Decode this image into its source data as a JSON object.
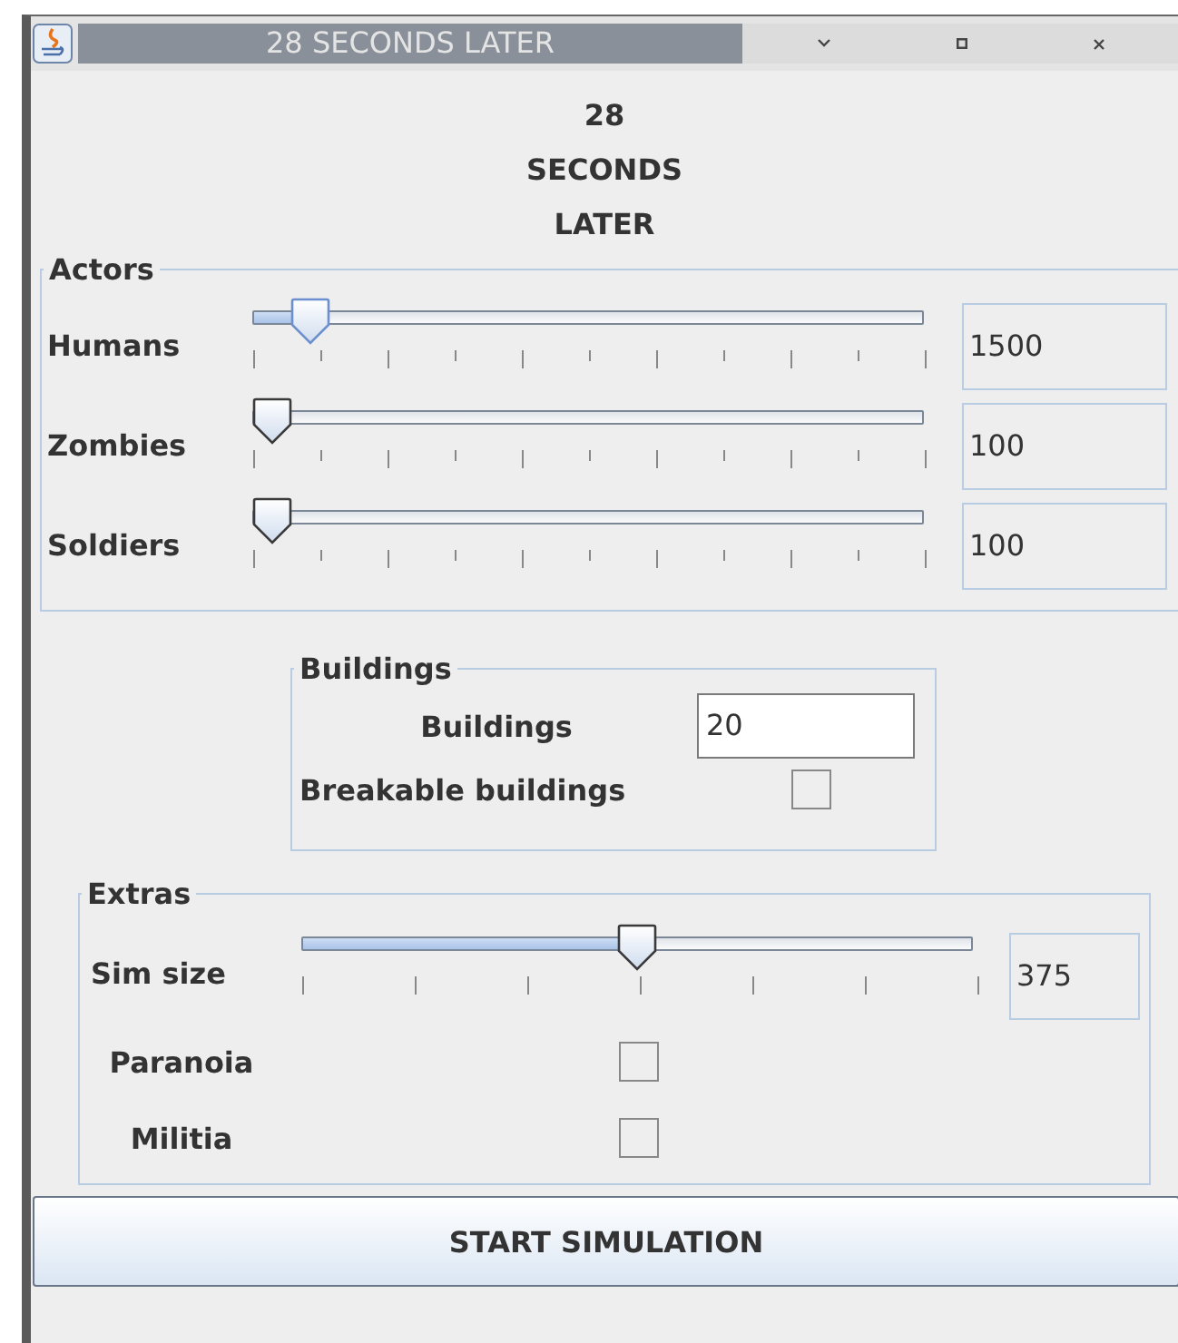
{
  "window": {
    "title": "28 SECONDS LATER"
  },
  "header": [
    "28",
    "SECONDS",
    "LATER"
  ],
  "actors": {
    "title": "Actors",
    "sliders": [
      {
        "label": "Humans",
        "level": 0.06,
        "value": "1500",
        "focused": true
      },
      {
        "label": "Zombies",
        "level": 0.0,
        "value": "100",
        "focused": false
      },
      {
        "label": "Soldiers",
        "level": 0.0,
        "value": "100",
        "focused": false
      }
    ]
  },
  "buildings": {
    "title": "Buildings",
    "field": {
      "label": "Buildings",
      "value": "20"
    },
    "checkbox": {
      "label": "Breakable buildings",
      "checked": false
    }
  },
  "extras": {
    "title": "Extras",
    "slider": {
      "label": "Sim size",
      "level": 0.5,
      "value": "375",
      "focused": false
    },
    "checkboxes": [
      {
        "label": "Paranoia",
        "checked": false
      },
      {
        "label": "Militia",
        "checked": false
      }
    ]
  },
  "button": {
    "label": "START SIMULATION"
  }
}
